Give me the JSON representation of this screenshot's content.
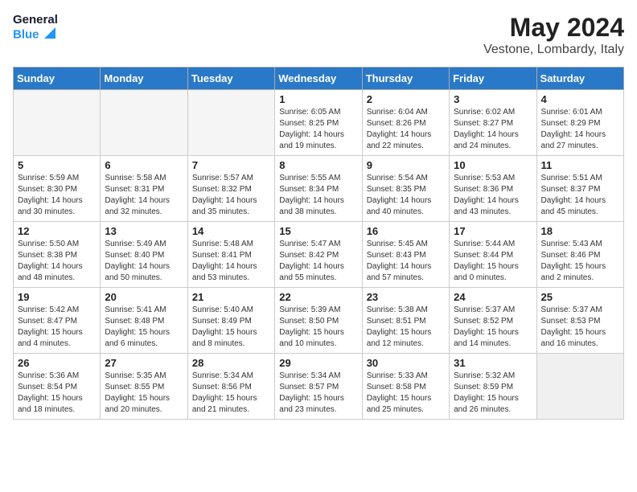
{
  "header": {
    "logo_line1": "General",
    "logo_line2": "Blue",
    "month": "May 2024",
    "location": "Vestone, Lombardy, Italy"
  },
  "weekdays": [
    "Sunday",
    "Monday",
    "Tuesday",
    "Wednesday",
    "Thursday",
    "Friday",
    "Saturday"
  ],
  "weeks": [
    [
      {
        "day": "",
        "info": "",
        "empty": true
      },
      {
        "day": "",
        "info": "",
        "empty": true
      },
      {
        "day": "",
        "info": "",
        "empty": true
      },
      {
        "day": "1",
        "info": "Sunrise: 6:05 AM\nSunset: 8:25 PM\nDaylight: 14 hours\nand 19 minutes."
      },
      {
        "day": "2",
        "info": "Sunrise: 6:04 AM\nSunset: 8:26 PM\nDaylight: 14 hours\nand 22 minutes."
      },
      {
        "day": "3",
        "info": "Sunrise: 6:02 AM\nSunset: 8:27 PM\nDaylight: 14 hours\nand 24 minutes."
      },
      {
        "day": "4",
        "info": "Sunrise: 6:01 AM\nSunset: 8:29 PM\nDaylight: 14 hours\nand 27 minutes."
      }
    ],
    [
      {
        "day": "5",
        "info": "Sunrise: 5:59 AM\nSunset: 8:30 PM\nDaylight: 14 hours\nand 30 minutes."
      },
      {
        "day": "6",
        "info": "Sunrise: 5:58 AM\nSunset: 8:31 PM\nDaylight: 14 hours\nand 32 minutes."
      },
      {
        "day": "7",
        "info": "Sunrise: 5:57 AM\nSunset: 8:32 PM\nDaylight: 14 hours\nand 35 minutes."
      },
      {
        "day": "8",
        "info": "Sunrise: 5:55 AM\nSunset: 8:34 PM\nDaylight: 14 hours\nand 38 minutes."
      },
      {
        "day": "9",
        "info": "Sunrise: 5:54 AM\nSunset: 8:35 PM\nDaylight: 14 hours\nand 40 minutes."
      },
      {
        "day": "10",
        "info": "Sunrise: 5:53 AM\nSunset: 8:36 PM\nDaylight: 14 hours\nand 43 minutes."
      },
      {
        "day": "11",
        "info": "Sunrise: 5:51 AM\nSunset: 8:37 PM\nDaylight: 14 hours\nand 45 minutes."
      }
    ],
    [
      {
        "day": "12",
        "info": "Sunrise: 5:50 AM\nSunset: 8:38 PM\nDaylight: 14 hours\nand 48 minutes."
      },
      {
        "day": "13",
        "info": "Sunrise: 5:49 AM\nSunset: 8:40 PM\nDaylight: 14 hours\nand 50 minutes."
      },
      {
        "day": "14",
        "info": "Sunrise: 5:48 AM\nSunset: 8:41 PM\nDaylight: 14 hours\nand 53 minutes."
      },
      {
        "day": "15",
        "info": "Sunrise: 5:47 AM\nSunset: 8:42 PM\nDaylight: 14 hours\nand 55 minutes."
      },
      {
        "day": "16",
        "info": "Sunrise: 5:45 AM\nSunset: 8:43 PM\nDaylight: 14 hours\nand 57 minutes."
      },
      {
        "day": "17",
        "info": "Sunrise: 5:44 AM\nSunset: 8:44 PM\nDaylight: 15 hours\nand 0 minutes."
      },
      {
        "day": "18",
        "info": "Sunrise: 5:43 AM\nSunset: 8:46 PM\nDaylight: 15 hours\nand 2 minutes."
      }
    ],
    [
      {
        "day": "19",
        "info": "Sunrise: 5:42 AM\nSunset: 8:47 PM\nDaylight: 15 hours\nand 4 minutes."
      },
      {
        "day": "20",
        "info": "Sunrise: 5:41 AM\nSunset: 8:48 PM\nDaylight: 15 hours\nand 6 minutes."
      },
      {
        "day": "21",
        "info": "Sunrise: 5:40 AM\nSunset: 8:49 PM\nDaylight: 15 hours\nand 8 minutes."
      },
      {
        "day": "22",
        "info": "Sunrise: 5:39 AM\nSunset: 8:50 PM\nDaylight: 15 hours\nand 10 minutes."
      },
      {
        "day": "23",
        "info": "Sunrise: 5:38 AM\nSunset: 8:51 PM\nDaylight: 15 hours\nand 12 minutes."
      },
      {
        "day": "24",
        "info": "Sunrise: 5:37 AM\nSunset: 8:52 PM\nDaylight: 15 hours\nand 14 minutes."
      },
      {
        "day": "25",
        "info": "Sunrise: 5:37 AM\nSunset: 8:53 PM\nDaylight: 15 hours\nand 16 minutes."
      }
    ],
    [
      {
        "day": "26",
        "info": "Sunrise: 5:36 AM\nSunset: 8:54 PM\nDaylight: 15 hours\nand 18 minutes."
      },
      {
        "day": "27",
        "info": "Sunrise: 5:35 AM\nSunset: 8:55 PM\nDaylight: 15 hours\nand 20 minutes."
      },
      {
        "day": "28",
        "info": "Sunrise: 5:34 AM\nSunset: 8:56 PM\nDaylight: 15 hours\nand 21 minutes."
      },
      {
        "day": "29",
        "info": "Sunrise: 5:34 AM\nSunset: 8:57 PM\nDaylight: 15 hours\nand 23 minutes."
      },
      {
        "day": "30",
        "info": "Sunrise: 5:33 AM\nSunset: 8:58 PM\nDaylight: 15 hours\nand 25 minutes."
      },
      {
        "day": "31",
        "info": "Sunrise: 5:32 AM\nSunset: 8:59 PM\nDaylight: 15 hours\nand 26 minutes."
      },
      {
        "day": "",
        "info": "",
        "empty": true
      }
    ]
  ]
}
